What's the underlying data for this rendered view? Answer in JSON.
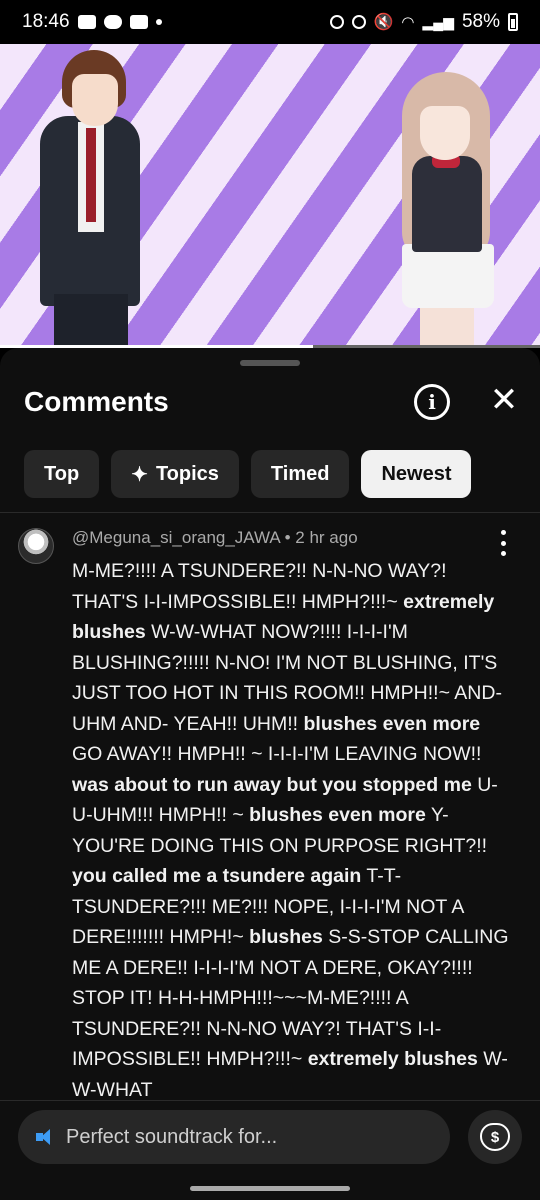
{
  "status_bar": {
    "time": "18:46",
    "battery": "58%"
  },
  "comments_panel": {
    "title": "Comments",
    "filters": [
      {
        "label": "Top",
        "active": false
      },
      {
        "label": "Topics",
        "active": false
      },
      {
        "label": "Timed",
        "active": false
      },
      {
        "label": "Newest",
        "active": true
      }
    ]
  },
  "comment": {
    "author": "@Meguna_si_orang_JAWA",
    "age": "2 hr ago",
    "segments": [
      {
        "text": "M-ME?!!!! A TSUNDERE?!! N-N-NO WAY?! THAT'S I-I-IMPOSSIBLE!! HMPH?!!!~ ",
        "bold": false
      },
      {
        "text": "extremely blushes",
        "bold": true
      },
      {
        "text": " W-W-WHAT NOW?!!!! I-I-I-I'M BLUSHING?!!!!! N-NO! I'M NOT BLUSHING, IT'S JUST TOO HOT IN THIS ROOM!! HMPH!!~ AND- UHM AND- YEAH!! UHM!! ",
        "bold": false
      },
      {
        "text": "blushes even more",
        "bold": true
      },
      {
        "text": " GO AWAY!! HMPH!! ~ I-I-I-I'M LEAVING NOW!! ",
        "bold": false
      },
      {
        "text": "was about to run away but you stopped me",
        "bold": true
      },
      {
        "text": " U-U-UHM!!! HMPH!! ~ ",
        "bold": false
      },
      {
        "text": "blushes even more",
        "bold": true
      },
      {
        "text": " Y-YOU'RE DOING THIS ON PURPOSE RIGHT?!! ",
        "bold": false
      },
      {
        "text": "you called me a tsundere again",
        "bold": true
      },
      {
        "text": " T-T-TSUNDERE?!!! ME?!!! NOPE, I-I-I-I'M NOT A DERE!!!!!!! HMPH!~ ",
        "bold": false
      },
      {
        "text": "blushes",
        "bold": true
      },
      {
        "text": " S-S-STOP CALLING ME A DERE!! I-I-I-I'M NOT A DERE, OKAY?!!!! STOP IT! H-H-HMPH!!!~~~M-ME?!!!! A TSUNDERE?!! N-N-NO WAY?! THAT'S I-I-IMPOSSIBLE!! HMPH?!!!~ ",
        "bold": false
      },
      {
        "text": "extremely blushes",
        "bold": true
      },
      {
        "text": " W-W-WHAT",
        "bold": false
      }
    ]
  },
  "composer": {
    "placeholder": "Perfect soundtrack for..."
  },
  "video": {
    "progress": 0.58
  },
  "icons": {
    "info": "info-icon",
    "close": "close-icon",
    "more": "more-vert-icon",
    "topics": "sparkle-icon",
    "speaker": "speaker-icon",
    "super_thanks": "super-thanks-icon"
  }
}
